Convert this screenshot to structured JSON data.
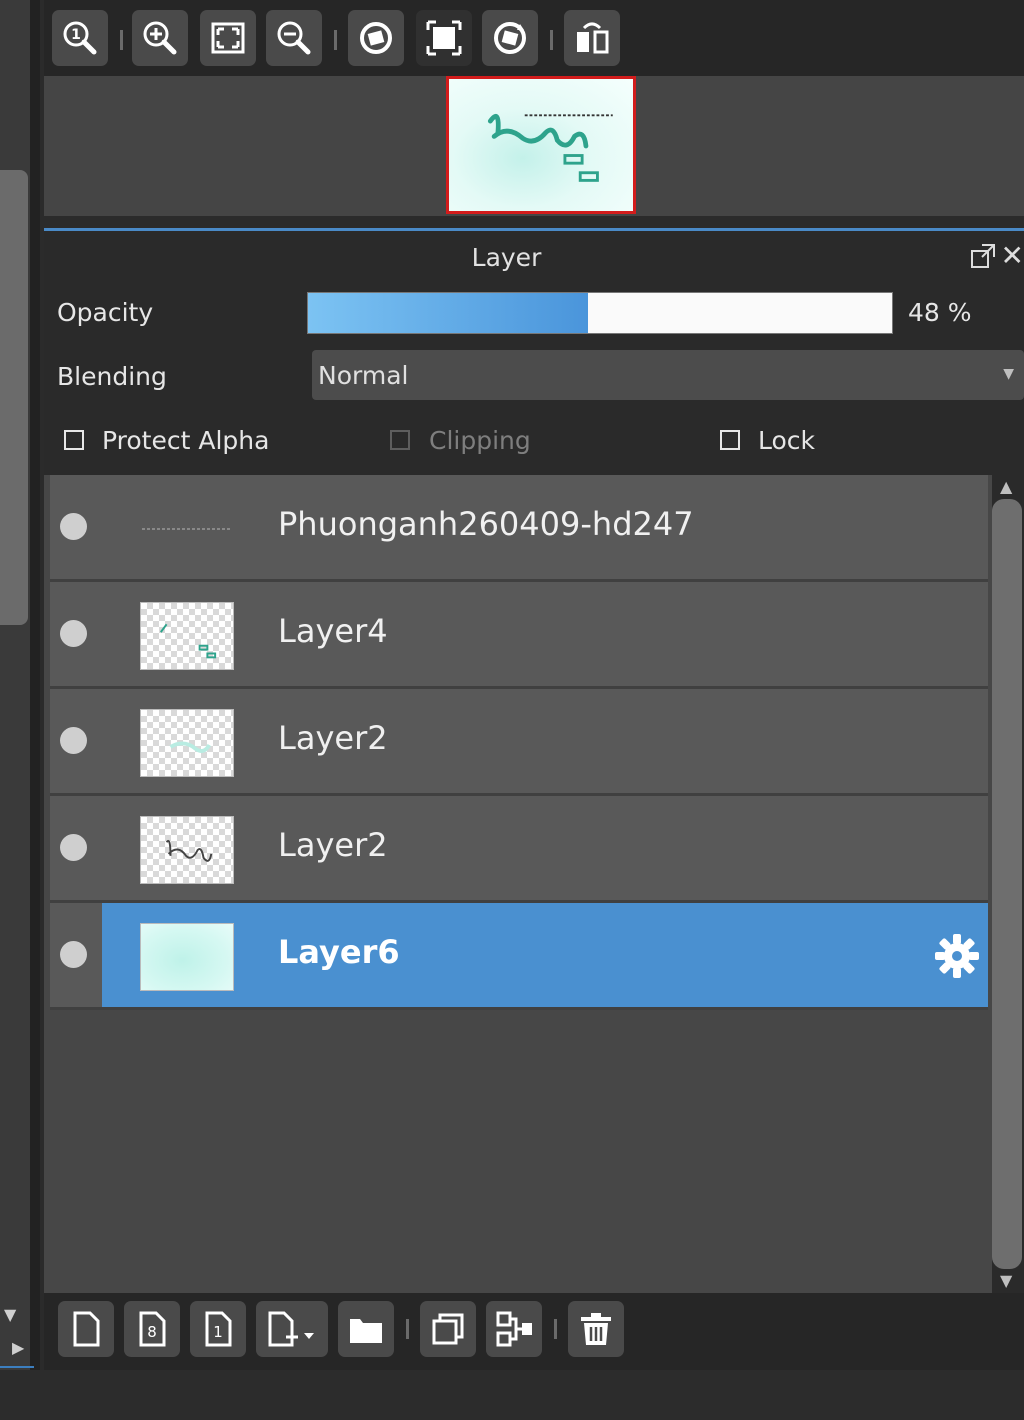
{
  "toolbar": {
    "buttons": [
      "zoom-actual-size",
      "zoom-in",
      "fit-to-window",
      "zoom-out",
      "rotate-reset",
      "fullscreen",
      "rotate",
      "flip"
    ]
  },
  "navigator": {
    "thumbnail": "canvas-preview"
  },
  "panel": {
    "title": "Layer"
  },
  "properties": {
    "opacity_label": "Opacity",
    "opacity_value": 48,
    "opacity_text": "48 %",
    "blending_label": "Blending",
    "blending_value": "Normal",
    "protect_alpha_label": "Protect Alpha",
    "protect_alpha_checked": false,
    "clipping_label": "Clipping",
    "clipping_checked": false,
    "clipping_enabled": false,
    "lock_label": "Lock",
    "lock_checked": false
  },
  "layers": [
    {
      "name": "Phuonganh260409-hd247",
      "selected": false,
      "visible": true
    },
    {
      "name": "Layer4",
      "selected": false,
      "visible": true
    },
    {
      "name": "Layer2",
      "selected": false,
      "visible": true
    },
    {
      "name": "Layer2",
      "selected": false,
      "visible": true
    },
    {
      "name": "Layer6",
      "selected": true,
      "visible": true
    }
  ],
  "bottom_bar": {
    "buttons": [
      "new-layer",
      "new-8bit-layer",
      "new-1bit-layer",
      "add-layer-menu",
      "new-folder",
      "duplicate-layer",
      "merge-down",
      "delete-layer"
    ]
  },
  "colors": {
    "accent": "#4a90d0",
    "selected_row": "#4a90d0",
    "navigator_frame": "#d21c1c",
    "opacity_fill": "#5aa8e6"
  }
}
